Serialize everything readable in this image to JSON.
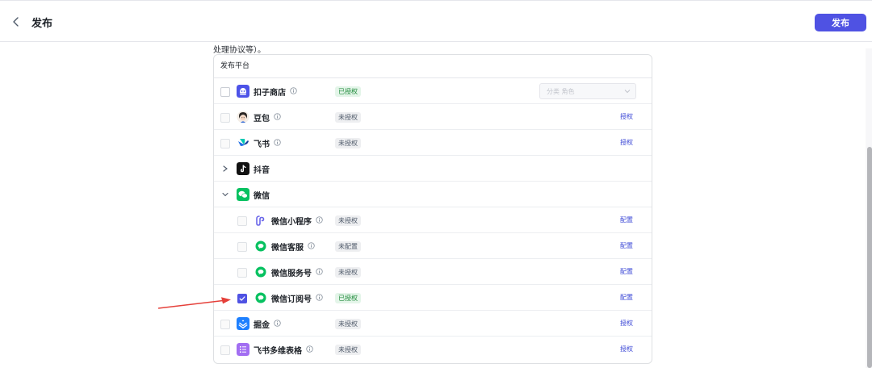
{
  "header": {
    "title": "发布",
    "publish_label": "发布"
  },
  "intro": {
    "text": "处理协议等）。"
  },
  "panel": {
    "title": "发布平台",
    "rows": [
      {
        "name": "扣子商店",
        "status": "已授权",
        "select_value": "分类 角色"
      },
      {
        "name": "豆包",
        "status": "未授权",
        "action": "授权"
      },
      {
        "name": "飞书",
        "status": "未授权",
        "action": "授权"
      },
      {
        "name": "抖音"
      },
      {
        "name": "微信"
      },
      {
        "name": "微信小程序",
        "status": "未授权",
        "action": "配置"
      },
      {
        "name": "微信客服",
        "status": "未配置",
        "action": "配置"
      },
      {
        "name": "微信服务号",
        "status": "未授权",
        "action": "配置"
      },
      {
        "name": "微信订阅号",
        "status": "已授权",
        "action": "配置"
      },
      {
        "name": "掘金",
        "status": "未授权",
        "action": "授权"
      },
      {
        "name": "飞书多维表格",
        "status": "未授权",
        "action": "授权"
      }
    ]
  },
  "colors": {
    "accent": "#4f52e3",
    "authorized_bg": "#e4f5e9",
    "authorized_text": "#1f8a3a",
    "annotation_arrow": "#e5403a"
  },
  "icons": {
    "back": "chevron-left-icon",
    "info": "info-circle-icon",
    "coze_store": "coze-store-icon",
    "doubao": "doubao-avatar-icon",
    "feishu": "feishu-icon",
    "douyin": "douyin-icon",
    "wechat": "wechat-icon",
    "juejin": "juejin-icon",
    "bitable": "feishu-bitable-icon"
  }
}
